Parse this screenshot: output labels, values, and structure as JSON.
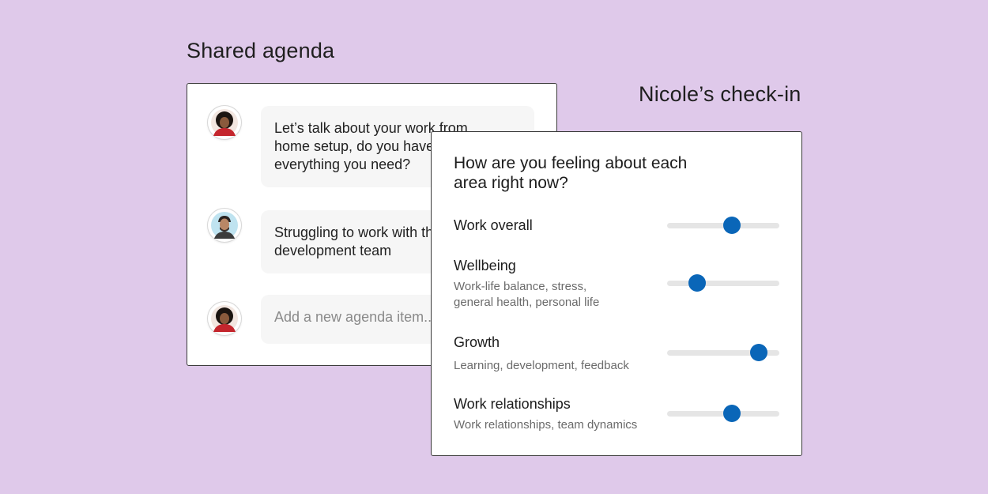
{
  "agenda": {
    "title": "Shared agenda",
    "items": [
      {
        "text": "Let’s talk about your work from\nhome setup, do you have\neverything you need?",
        "avatar": "woman-avatar"
      },
      {
        "text": "Struggling to work with the\ndevelopment team",
        "avatar": "man-avatar"
      }
    ],
    "new_item_placeholder": "Add a new agenda item..."
  },
  "checkin": {
    "title": "Nicole’s check-in",
    "question": "How are you feeling about each\narea right now?",
    "metrics": [
      {
        "label": "Work overall",
        "description": "",
        "value": 0.58
      },
      {
        "label": "Wellbeing",
        "description": "Work-life balance, stress,\ngeneral health, personal life",
        "value": 0.27
      },
      {
        "label": "Growth",
        "description": "Learning, development, feedback",
        "value": 0.82
      },
      {
        "label": "Work relationships",
        "description": "Work relationships, team dynamics",
        "value": 0.58
      }
    ],
    "accent_color": "#0a66b8"
  }
}
